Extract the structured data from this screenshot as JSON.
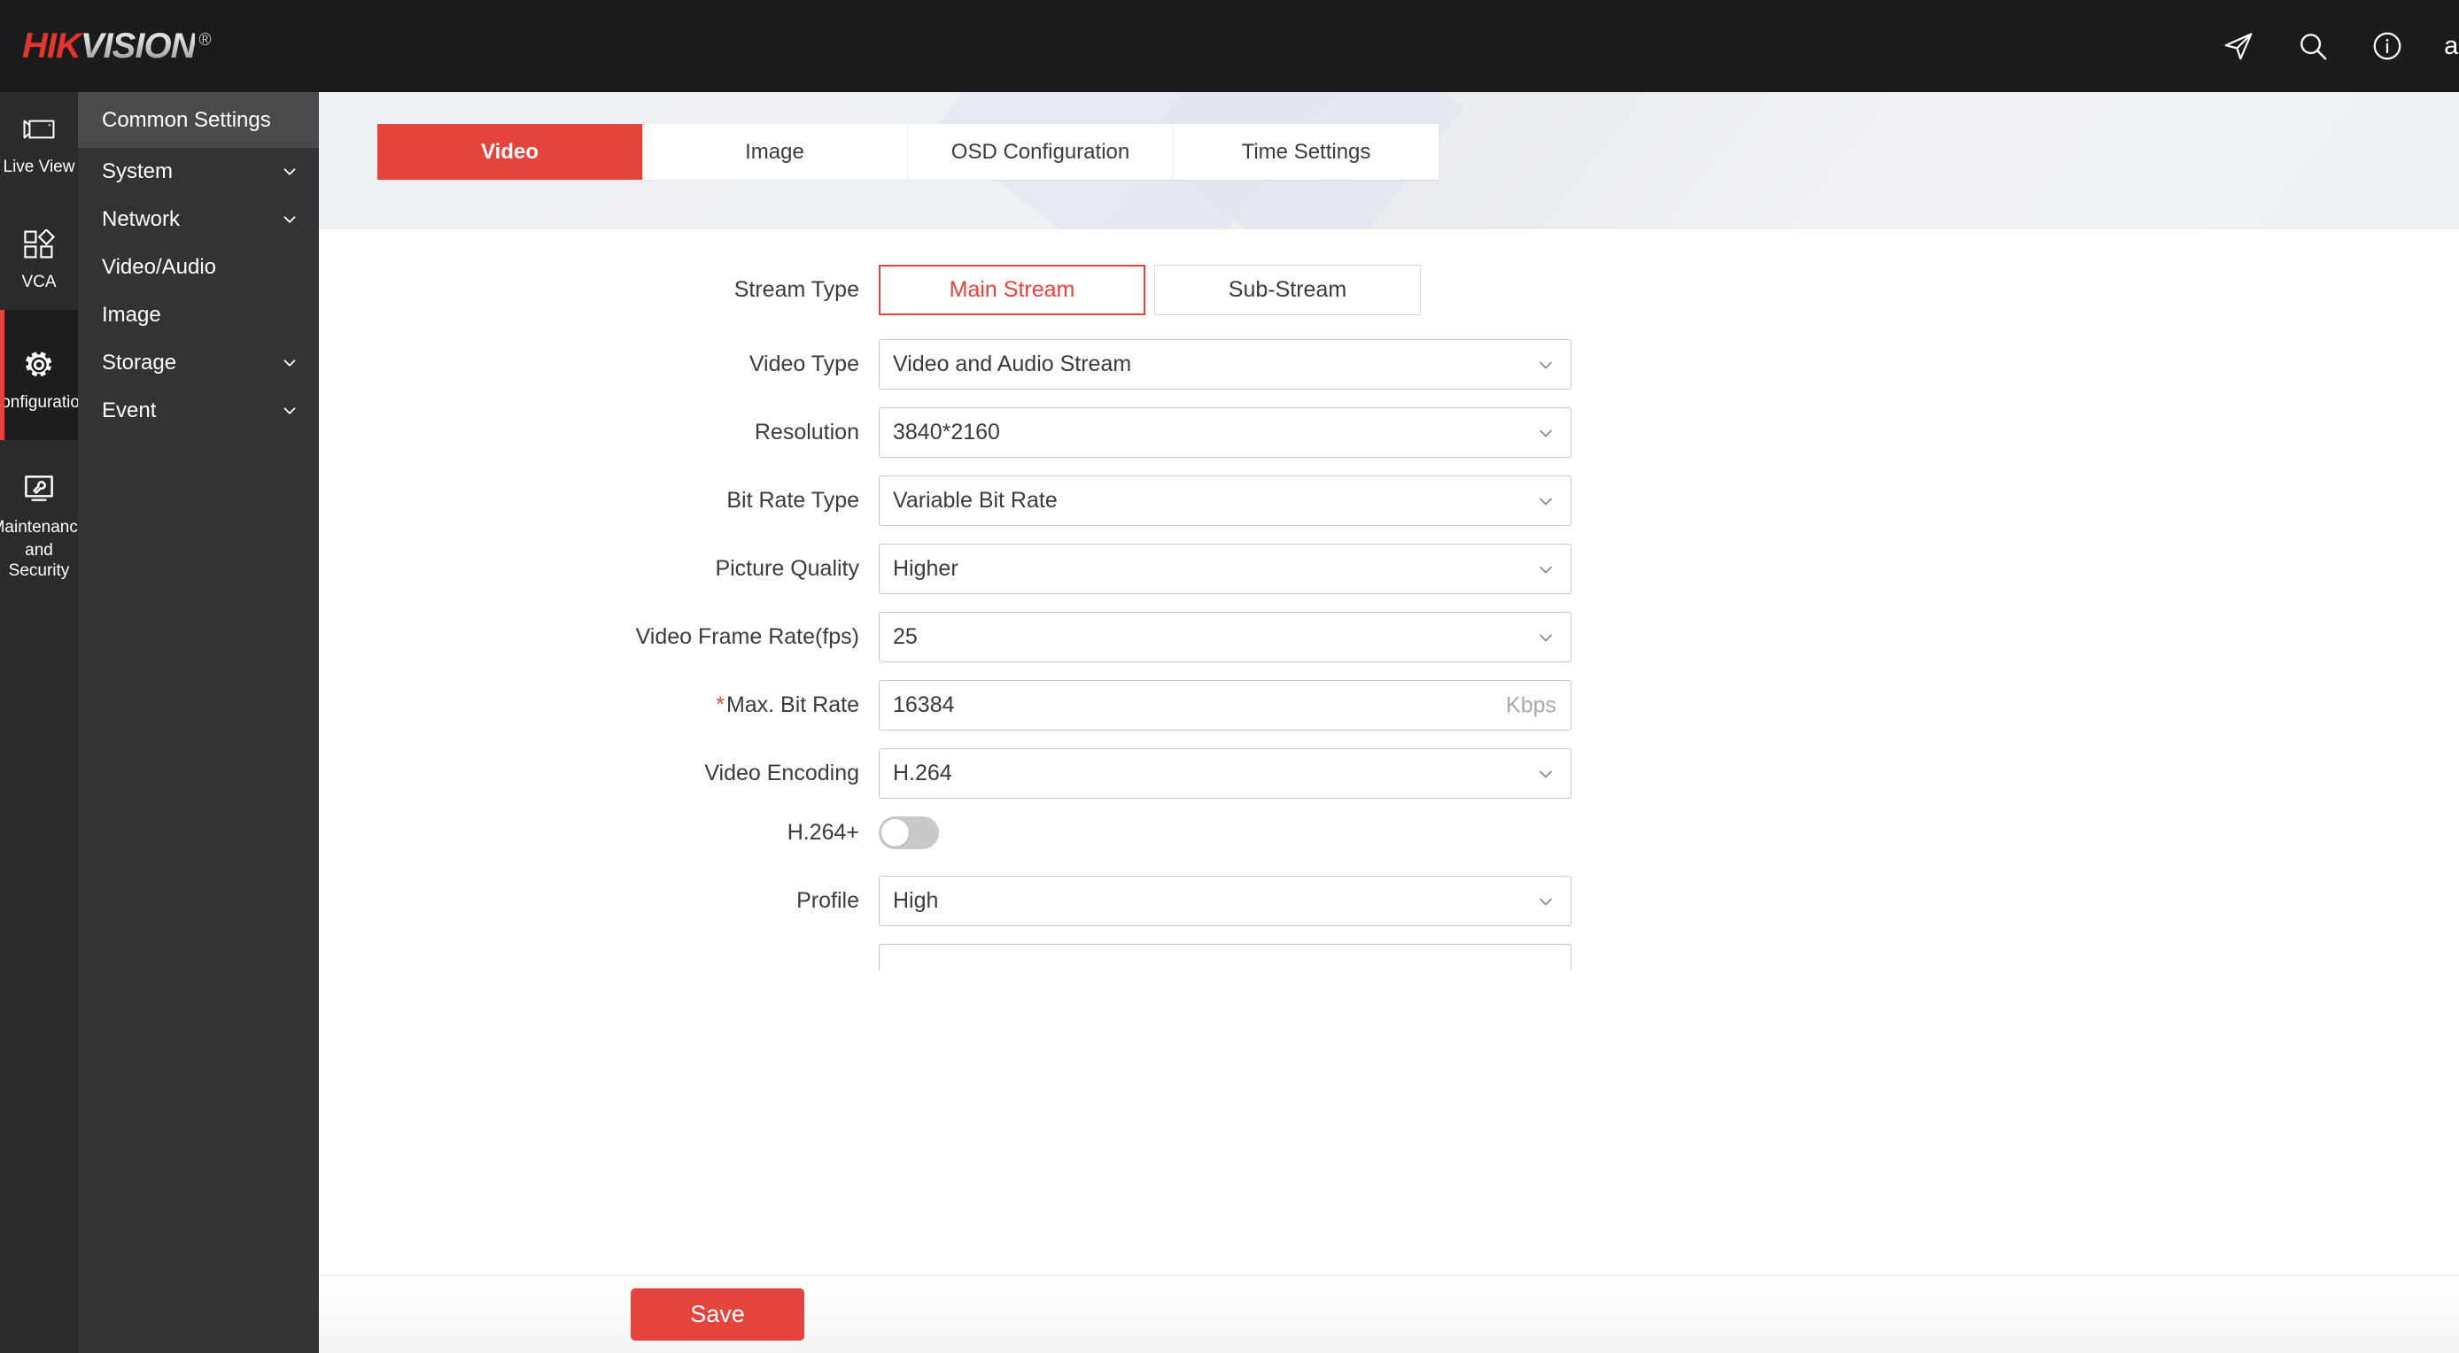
{
  "header": {
    "brand_primary": "HIK",
    "brand_secondary": "VISION",
    "brand_reg": "®",
    "brand_color": "#e2352b",
    "icons": [
      {
        "name": "send-icon",
        "label": "send"
      },
      {
        "name": "search-icon",
        "label": "search"
      },
      {
        "name": "info-icon",
        "label": "info"
      }
    ],
    "user": "admi"
  },
  "rail": {
    "items": [
      {
        "label": "Live View",
        "icon": "camera-icon",
        "active": false
      },
      {
        "label": "VCA",
        "icon": "grid-shapes-icon",
        "active": false
      },
      {
        "label": "Configuration",
        "icon": "gear-icon",
        "active": true
      },
      {
        "label": "Maintenance and Security",
        "icon": "monitor-wrench-icon",
        "active": false
      }
    ],
    "maintenance_line1": "Maintenance",
    "maintenance_line2": "and Security"
  },
  "subnav": {
    "items": [
      {
        "label": "Common Settings",
        "expandable": false,
        "active": true
      },
      {
        "label": "System",
        "expandable": true,
        "active": false
      },
      {
        "label": "Network",
        "expandable": true,
        "active": false
      },
      {
        "label": "Video/Audio",
        "expandable": false,
        "active": false
      },
      {
        "label": "Image",
        "expandable": false,
        "active": false
      },
      {
        "label": "Storage",
        "expandable": true,
        "active": false
      },
      {
        "label": "Event",
        "expandable": true,
        "active": false
      }
    ]
  },
  "tabs": [
    {
      "label": "Video",
      "active": true
    },
    {
      "label": "Image",
      "active": false
    },
    {
      "label": "OSD Configuration",
      "active": false
    },
    {
      "label": "Time Settings",
      "active": false
    }
  ],
  "form": {
    "stream_type": {
      "label": "Stream Type",
      "options": [
        "Main Stream",
        "Sub-Stream"
      ],
      "selected": "Main Stream"
    },
    "fields": [
      {
        "label": "Video Type",
        "value": "Video and Audio Stream",
        "type": "select",
        "required": false
      },
      {
        "label": "Resolution",
        "value": "3840*2160",
        "type": "select",
        "required": false
      },
      {
        "label": "Bit Rate Type",
        "value": "Variable Bit Rate",
        "type": "select",
        "required": false
      },
      {
        "label": "Picture Quality",
        "value": "Higher",
        "type": "select",
        "required": false
      },
      {
        "label": "Video Frame Rate(fps)",
        "value": "25",
        "type": "select",
        "required": false
      },
      {
        "label": "Max. Bit Rate",
        "value": "16384",
        "type": "input",
        "unit": "Kbps",
        "required": true
      },
      {
        "label": "Video Encoding",
        "value": "H.264",
        "type": "select",
        "required": false
      },
      {
        "label": "H.264+",
        "value": "",
        "type": "toggle",
        "toggle_on": false,
        "required": false
      },
      {
        "label": "Profile",
        "value": "High",
        "type": "select",
        "required": false
      }
    ]
  },
  "footer": {
    "save_label": "Save",
    "accent": "#e3443c"
  }
}
